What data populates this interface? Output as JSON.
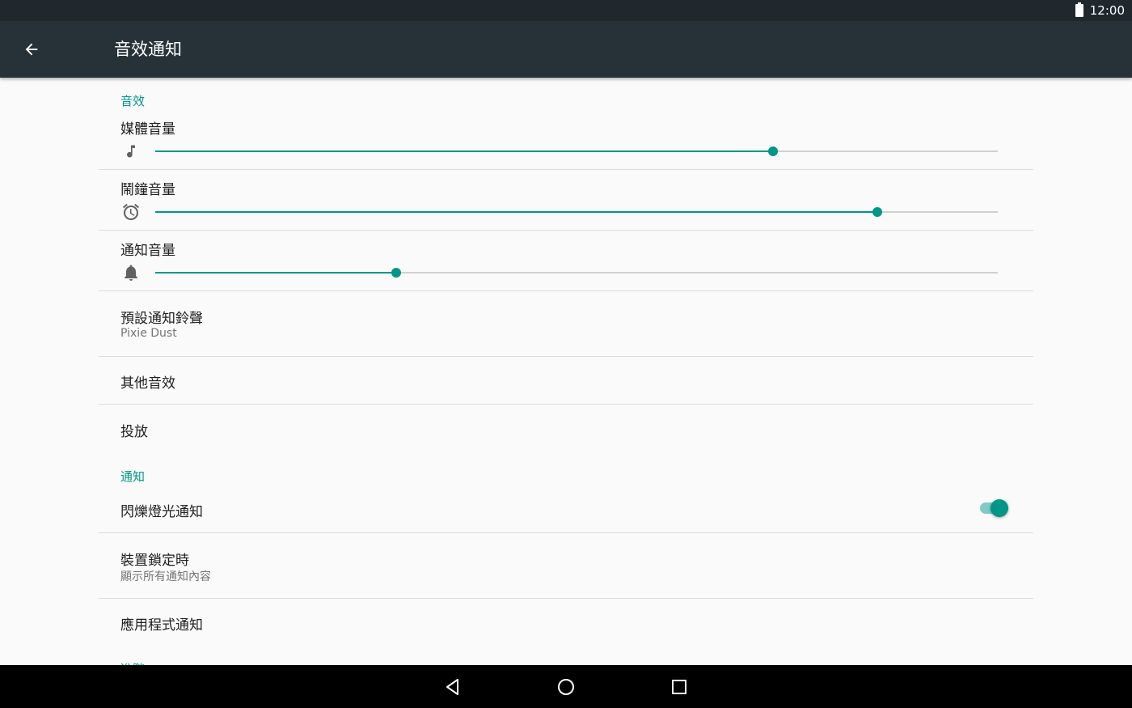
{
  "status_bar": {
    "time": "12:00",
    "battery_icon": "battery-full-icon"
  },
  "app_bar": {
    "back_icon": "arrow-back-icon",
    "title": "音效通知"
  },
  "sound_section": {
    "header": "音效",
    "media_volume": {
      "label": "媒體音量",
      "icon": "music-note-icon",
      "level": 0.733
    },
    "alarm_volume": {
      "label": "鬧鐘音量",
      "icon": "alarm-clock-icon",
      "level": 0.857
    },
    "notification_volume": {
      "label": "通知音量",
      "icon": "bell-icon",
      "level": 0.286
    },
    "default_ringtone": {
      "title": "預設通知鈴聲",
      "summary": "Pixie Dust"
    },
    "other_sounds": {
      "title": "其他音效"
    },
    "cast": {
      "title": "投放"
    }
  },
  "notification_section": {
    "header": "通知",
    "blink_light": {
      "title": "閃爍燈光通知",
      "enabled": true
    },
    "on_lock_screen": {
      "title": "裝置鎖定時",
      "summary": "顯示所有通知內容"
    },
    "app_notifications": {
      "title": "應用程式通知"
    },
    "next_header_partial": "進階"
  },
  "colors": {
    "accent": "#009688",
    "app_bar": "#263238",
    "status_bar": "#20282e",
    "nav_bar": "#000000"
  },
  "nav_bar": {
    "back_icon": "nav-back-icon",
    "home_icon": "nav-home-icon",
    "recents_icon": "nav-recents-icon"
  }
}
